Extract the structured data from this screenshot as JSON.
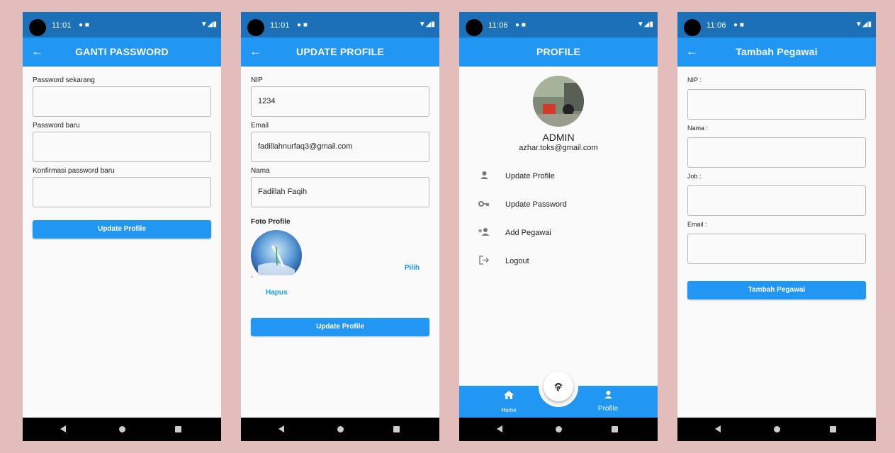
{
  "status_bars": [
    {
      "time": "11:01"
    },
    {
      "time": "11:01"
    },
    {
      "time": "11:06"
    },
    {
      "time": "11:06"
    }
  ],
  "screen1": {
    "title": "GANTI PASSWORD",
    "labels": [
      "Password sekarang",
      "Password baru",
      "Konfirmasi password baru"
    ],
    "values": [
      "",
      "",
      ""
    ],
    "button": "Update Profile"
  },
  "screen2": {
    "title": "UPDATE PROFILE",
    "labels": [
      "NIP",
      "Email",
      "Nama"
    ],
    "values": [
      "1234",
      "fadillahnurfaq3@gmail.com",
      "Fadillah Faqih"
    ],
    "photo_label": "Foto Profile",
    "pick_label": "Pilih",
    "delete_label": "Hapus",
    "button": "Update Profile"
  },
  "screen3": {
    "title": "PROFILE",
    "name": "ADMIN",
    "email": "azhar.toks@gmail.com",
    "menu": [
      {
        "label": "Update Profile",
        "icon": "person-icon"
      },
      {
        "label": "Update Password",
        "icon": "key-icon"
      },
      {
        "label": "Add Pegawai",
        "icon": "person-add-icon"
      },
      {
        "label": "Logout",
        "icon": "logout-icon"
      }
    ],
    "bottom_nav": [
      {
        "label": "Home",
        "icon": "home-icon"
      },
      {
        "label": "Profile",
        "icon": "person-icon"
      }
    ],
    "fab_icon": "fingerprint-icon"
  },
  "screen4": {
    "title": "Tambah Pegawai",
    "labels": [
      "NIP :",
      "Nama :",
      "Job :",
      "Email :"
    ],
    "values": [
      "",
      "",
      "",
      ""
    ],
    "button": "Tambah Pegawai"
  },
  "colors": {
    "primary": "#2196f3",
    "status_bar": "#1c70b8",
    "background": "#e3bcbc"
  }
}
